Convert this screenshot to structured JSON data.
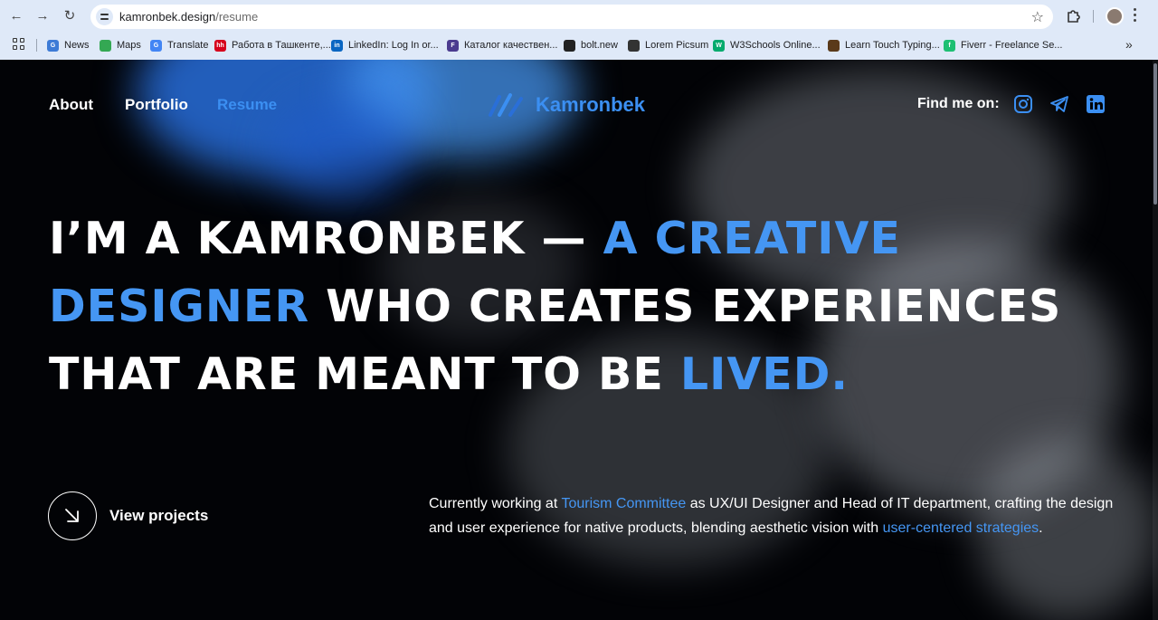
{
  "browser": {
    "url_host": "kamronbek.design",
    "url_path": "/resume",
    "bookmarks": [
      {
        "label": "News",
        "color": "#3d7bd6",
        "glyph": "G"
      },
      {
        "label": "Maps",
        "color": "#34a853",
        "glyph": ""
      },
      {
        "label": "Translate",
        "color": "#4285f4",
        "glyph": "G"
      },
      {
        "label": "Работа в Ташкенте,...",
        "color": "#d6001c",
        "glyph": "hh"
      },
      {
        "label": "LinkedIn: Log In or...",
        "color": "#0a66c2",
        "glyph": "in"
      },
      {
        "label": "Каталог качествен...",
        "color": "#4b3b8f",
        "glyph": "F"
      },
      {
        "label": "bolt.new",
        "color": "#222222",
        "glyph": ""
      },
      {
        "label": "Lorem Picsum",
        "color": "#333333",
        "glyph": ""
      },
      {
        "label": "W3Schools Online...",
        "color": "#04aa6d",
        "glyph": "W"
      },
      {
        "label": "Learn Touch Typing...",
        "color": "#5a3a1a",
        "glyph": ""
      },
      {
        "label": "Fiverr - Freelance Se...",
        "color": "#1dbf73",
        "glyph": "f"
      }
    ]
  },
  "nav": {
    "about": "About",
    "portfolio": "Portfolio",
    "resume": "Resume",
    "logo": "Kamronbek",
    "find_me": "Find me on:"
  },
  "headline": {
    "part1": "I’M A KAMRONBEK — ",
    "part2": "A CREATIVE",
    "part3": "DESIGNER",
    "part4": " WHO CREATES EXPERIENCES",
    "part5": "THAT ARE MEANT TO BE ",
    "part6": "LIVED."
  },
  "cta": {
    "view_projects": "View projects"
  },
  "about": {
    "t1": "Currently working at ",
    "link1": "Tourism Committee",
    "t2": " as UX/UI Designer and Head of IT department, crafting the design and user experience for native products, blending aesthetic vision with ",
    "link2": "user-centered strategies",
    "t3": "."
  },
  "colors": {
    "accent": "#4596f3",
    "background": "#020306",
    "chrome": "#dfe9f8"
  },
  "icons": {
    "back": "arrow-left-icon",
    "forward": "arrow-right-icon",
    "reload": "reload-icon",
    "social": [
      "instagram-icon",
      "telegram-icon",
      "linkedin-icon"
    ],
    "cta": "arrow-down-right-icon"
  }
}
